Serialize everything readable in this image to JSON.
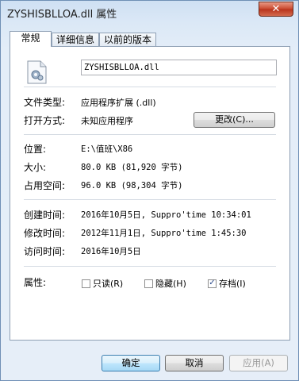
{
  "window": {
    "title": "ZYSHISBLLOA.dll 属性",
    "close_glyph": "✕"
  },
  "tabs": [
    {
      "label": "常规"
    },
    {
      "label": "详细信息"
    },
    {
      "label": "以前的版本"
    }
  ],
  "general": {
    "file_name": "ZYSHISBLLOA.dll",
    "file_type_label": "文件类型:",
    "file_type_value": "应用程序扩展 (.dll)",
    "open_with_label": "打开方式:",
    "open_with_value": "未知应用程序",
    "change_button": "更改(C)...",
    "location_label": "位置:",
    "location_value": "E:\\值班\\X86",
    "size_label": "大小:",
    "size_value": "80.0 KB (81,920 字节)",
    "size_on_disk_label": "占用空间:",
    "size_on_disk_value": "96.0 KB (98,304 字节)",
    "created_label": "创建时间:",
    "created_value": "2016年10月5日, Suppro'time 10:34:01",
    "modified_label": "修改时间:",
    "modified_value": "2012年11月1日, Suppro'time 1:45:30",
    "accessed_label": "访问时间:",
    "accessed_value": "2016年10月5日",
    "attributes_label": "属性:",
    "attr_readonly": "只读(R)",
    "attr_hidden": "隐藏(H)",
    "attr_archive": "存档(I)",
    "checkmark": "✓"
  },
  "footer": {
    "ok": "确定",
    "cancel": "取消",
    "apply": "应用(A)"
  }
}
